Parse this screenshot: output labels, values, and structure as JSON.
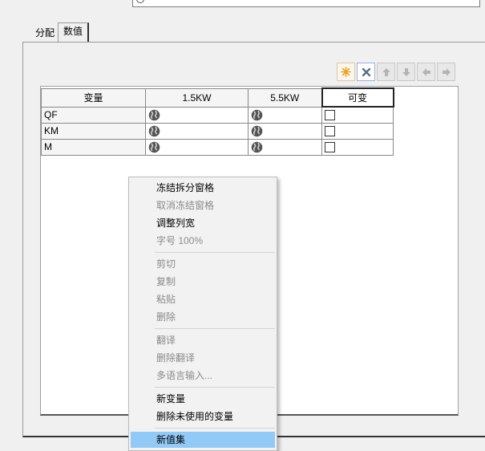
{
  "top": {
    "label": "",
    "input_value": ""
  },
  "tabs": [
    {
      "label": "分配",
      "active": false
    },
    {
      "label": "数值",
      "active": true
    }
  ],
  "toolbar": {
    "buttons": [
      {
        "icon": "asterisk-icon",
        "color": "#f0a020",
        "enabled": true
      },
      {
        "icon": "delete-x-icon",
        "color": "#4a6fa0",
        "enabled": true
      },
      {
        "icon": "arrow-up-icon",
        "enabled": false
      },
      {
        "icon": "arrow-down-icon",
        "enabled": false
      },
      {
        "icon": "arrow-left-icon",
        "enabled": false
      },
      {
        "icon": "arrow-right-icon",
        "enabled": false
      }
    ]
  },
  "table": {
    "headers": [
      "变量",
      "1.5KW",
      "5.5KW",
      "可变"
    ],
    "rows": [
      {
        "name": "QF",
        "checked": false
      },
      {
        "name": "KM",
        "checked": false
      },
      {
        "name": "M",
        "checked": false
      }
    ]
  },
  "context_menu": {
    "items": [
      {
        "label": "冻结拆分窗格",
        "enabled": true
      },
      {
        "label": "取消冻结窗格",
        "enabled": false
      },
      {
        "label": "调整列宽",
        "enabled": true
      },
      {
        "label": "字号 100%",
        "enabled": false
      },
      {
        "label": "剪切",
        "enabled": false
      },
      {
        "label": "复制",
        "enabled": false
      },
      {
        "label": "粘贴",
        "enabled": false
      },
      {
        "label": "删除",
        "enabled": false
      },
      {
        "label": "翻译",
        "enabled": false
      },
      {
        "label": "删除翻译",
        "enabled": false
      },
      {
        "label": "多语言输入...",
        "enabled": false
      },
      {
        "label": "新变量",
        "enabled": true
      },
      {
        "label": "删除未使用的变量",
        "enabled": true
      },
      {
        "label": "新值集",
        "enabled": true,
        "highlighted": true
      }
    ]
  }
}
